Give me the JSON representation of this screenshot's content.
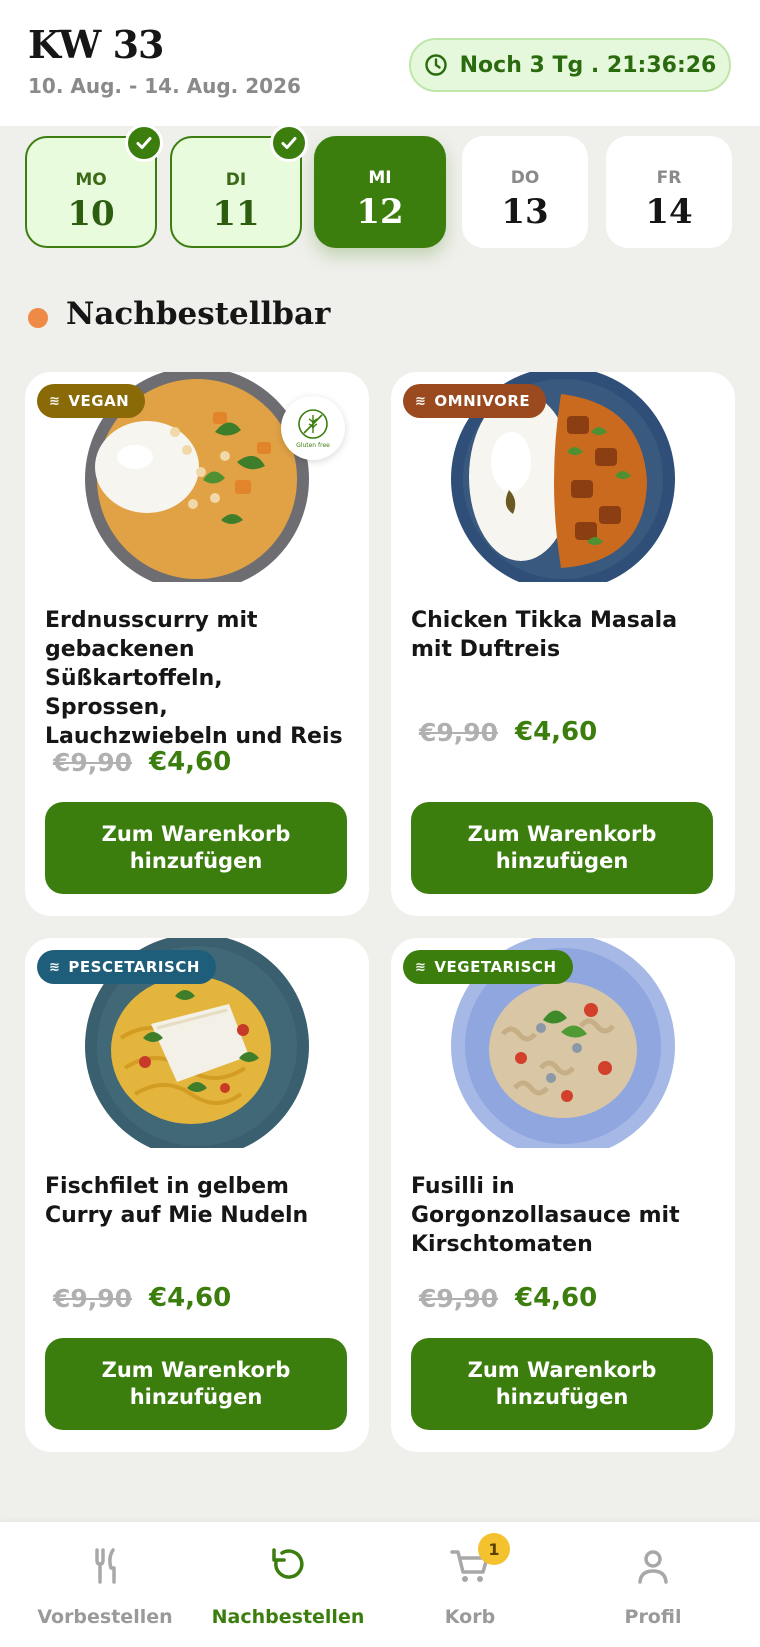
{
  "header": {
    "week": "KW 33",
    "range": "10. Aug. - 14. Aug. 2026",
    "countdown": "Noch 3 Tg . 21:36:26"
  },
  "days": [
    {
      "abbr": "MO",
      "num": "10",
      "state": "done"
    },
    {
      "abbr": "DI",
      "num": "11",
      "state": "done"
    },
    {
      "abbr": "MI",
      "num": "12",
      "state": "active"
    },
    {
      "abbr": "DO",
      "num": "13",
      "state": "future"
    },
    {
      "abbr": "FR",
      "num": "14",
      "state": "future"
    }
  ],
  "section": {
    "title": "Nachbestellbar"
  },
  "dishes": [
    {
      "badge": "VEGAN",
      "badge_color": "#8a6a06",
      "gluten_free": "Gluten free",
      "name": "Erdnusscurry mit gebackenen Süßkartoffeln, Sprossen, Lauchzwiebeln und Reis",
      "price_old": "€9,90",
      "price_new": "€4,60",
      "button": "Zum Warenkorb hinzufügen"
    },
    {
      "badge": "OMNIVORE",
      "badge_color": "#9a4a1e",
      "name": "Chicken Tikka Masala mit Duftreis",
      "price_old": "€9,90",
      "price_new": "€4,60",
      "button": "Zum Warenkorb hinzufügen"
    },
    {
      "badge": "PESCETARISCH",
      "badge_color": "#1f5e7a",
      "name": "Fischfilet in gelbem Curry auf Mie Nudeln",
      "price_old": "€9,90",
      "price_new": "€4,60",
      "button": "Zum Warenkorb hinzufügen"
    },
    {
      "badge": "VEGETARISCH",
      "badge_color": "#3c7e0e",
      "name": "Fusilli in Gorgonzollasauce mit Kirschtomaten",
      "price_old": "€9,90",
      "price_new": "€4,60",
      "button": "Zum Warenkorb hinzufügen"
    }
  ],
  "nav": {
    "items": [
      {
        "label": "Vorbestellen",
        "icon": "cutlery-icon"
      },
      {
        "label": "Nachbestellen",
        "icon": "reorder-icon"
      },
      {
        "label": "Korb",
        "icon": "cart-icon"
      },
      {
        "label": "Profil",
        "icon": "profile-icon"
      }
    ],
    "cart_count": "1"
  },
  "colors": {
    "accent": "#3c7e0e",
    "orange": "#ee8a45"
  }
}
